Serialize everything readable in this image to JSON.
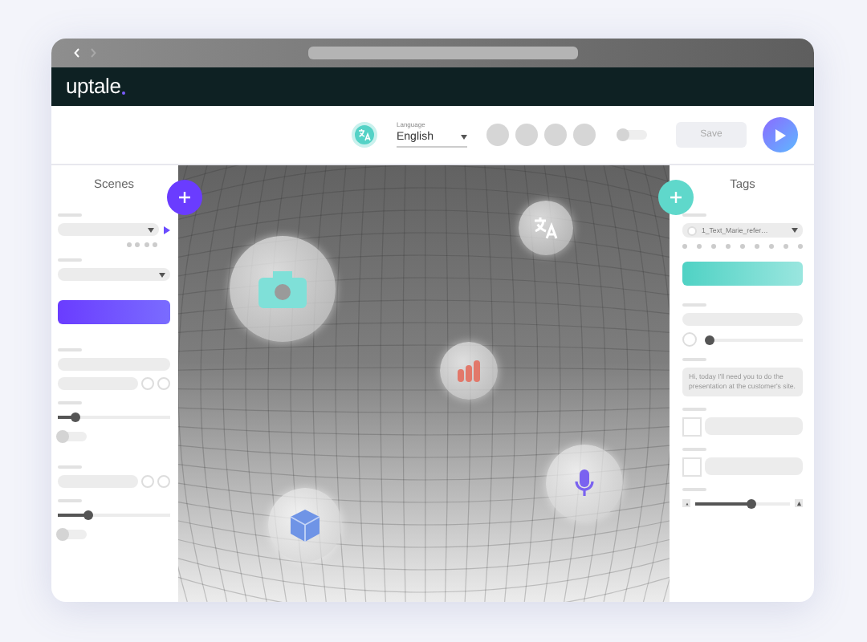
{
  "app": {
    "logo": "uptale"
  },
  "toolbar": {
    "language_label": "Language",
    "language_value": "English",
    "toggle_on": false,
    "save": "Save"
  },
  "scenes": {
    "title": "Scenes",
    "toggles": [
      false,
      false
    ],
    "sliders": [
      {
        "level": 0.15
      },
      {
        "level": 0.27
      }
    ],
    "option_rows": [
      [
        {
          "checked": false
        },
        {
          "checked": false
        }
      ],
      [
        {
          "checked": false
        },
        {
          "checked": false
        }
      ]
    ]
  },
  "viewport": {
    "hotspots": [
      {
        "kind": "camera"
      },
      {
        "kind": "translate"
      },
      {
        "kind": "chart"
      },
      {
        "kind": "microphone"
      },
      {
        "kind": "cube"
      }
    ]
  },
  "tags": {
    "title": "Tags",
    "tag_select": "1_Text_Marie_refer…",
    "message": "Hi, today I'll need you to do the presentation at the customer's site.",
    "volume": {
      "level": 0.0,
      "checked": false
    },
    "checkboxes": [
      {
        "checked": false
      },
      {
        "checked": false
      }
    ],
    "size": {
      "level": 0.6
    }
  }
}
